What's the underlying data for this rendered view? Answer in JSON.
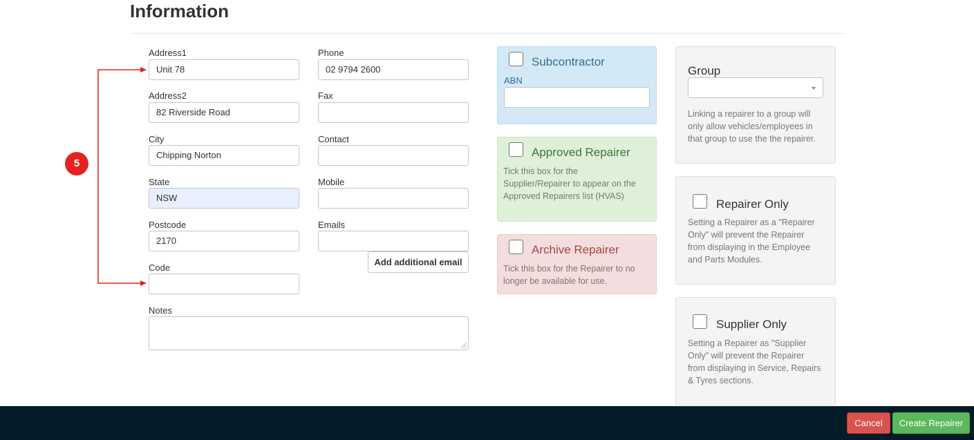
{
  "page": {
    "title": "Information"
  },
  "form": {
    "address1": {
      "label": "Address1",
      "value": "Unit 78"
    },
    "address2": {
      "label": "Address2",
      "value": "82 Riverside Road"
    },
    "city": {
      "label": "City",
      "value": "Chipping Norton"
    },
    "state": {
      "label": "State",
      "value": "NSW"
    },
    "postcode": {
      "label": "Postcode",
      "value": "2170"
    },
    "code": {
      "label": "Code",
      "value": ""
    },
    "notes": {
      "label": "Notes",
      "value": ""
    },
    "phone": {
      "label": "Phone",
      "value": "02 9794 2600"
    },
    "fax": {
      "label": "Fax",
      "value": ""
    },
    "contact": {
      "label": "Contact",
      "value": ""
    },
    "mobile": {
      "label": "Mobile",
      "value": ""
    },
    "emails": {
      "label": "Emails",
      "value": ""
    },
    "add_email_label": "Add additional email"
  },
  "panels": {
    "subcontractor": {
      "title": "Subcontractor",
      "abn_label": "ABN",
      "abn_value": ""
    },
    "approved": {
      "title": "Approved Repairer",
      "line1": "Tick this box for the",
      "line2": "Supplier/Repairer to appear on the",
      "line3": "Approved Repairers list (HVAS)"
    },
    "archive": {
      "title": "Archive Repairer",
      "line1": "Tick this box for the Repairer to no",
      "line2": "longer be available for use."
    },
    "group": {
      "title": "Group",
      "selected": "",
      "line1": "Linking a repairer to a group will",
      "line2": "only allow vehicles/employees in",
      "line3": "that group to use the the repairer."
    },
    "repairer_only": {
      "title": "Repairer Only",
      "line1": "Setting a Repairer as a \"Repairer",
      "line2": "Only\" will prevent the Repairer",
      "line3": "from displaying in the Employee",
      "line4": "and Parts Modules."
    },
    "supplier_only": {
      "title": "Supplier Only",
      "line1": "Setting a Repairer as \"Supplier",
      "line2": "Only\" will prevent the Repairer",
      "line3": "from displaying in Service, Repairs",
      "line4": "& Tyres sections."
    }
  },
  "annotation": {
    "step": "5",
    "color": "#e5221f"
  },
  "footer": {
    "cancel_label": "Cancel",
    "create_label": "Create Repairer"
  },
  "colors": {
    "footer_bg": "#041c27",
    "cancel": "#d9534f",
    "create": "#5cb85c"
  }
}
